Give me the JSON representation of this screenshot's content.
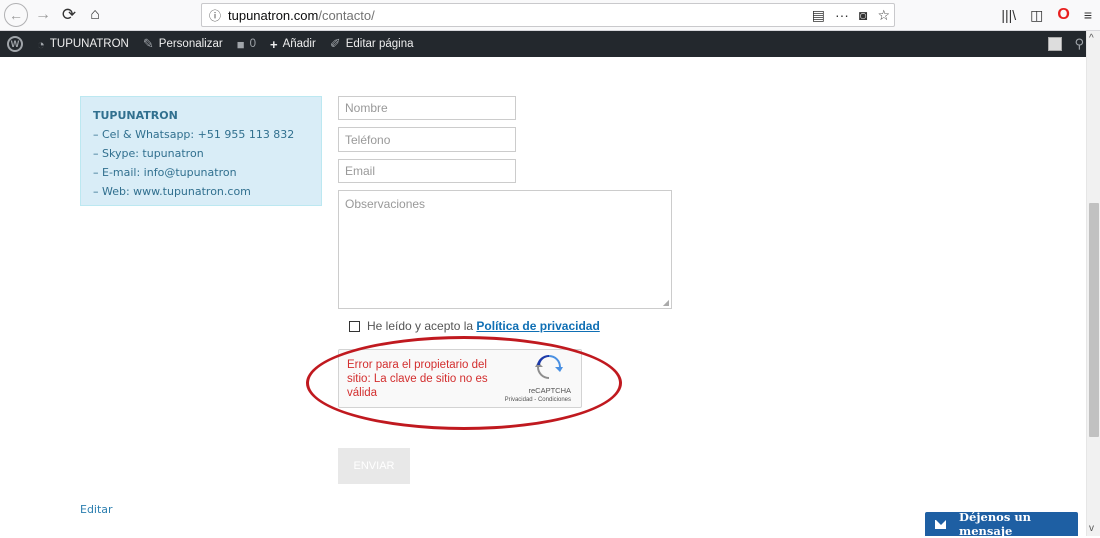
{
  "browser": {
    "back_icon": "←",
    "forward_icon": "→",
    "reload_icon": "⟳",
    "home_icon": "⌂",
    "info_icon": "ⓘ",
    "url_host": "tupunatron.com",
    "url_path": "/contacto/",
    "reader_icon": "▤",
    "more_icon": "···",
    "pocket_icon": "◙",
    "bookmark_icon": "☆",
    "library_icon": "|||\\",
    "sidebar_icon": "◫",
    "opera_icon": "O",
    "menu_icon": "≡"
  },
  "wp_admin_bar": {
    "logo": "W",
    "site_name": "TUPUNATRON",
    "customize": "Personalizar",
    "comments_count": "0",
    "add_new": "Añadir",
    "edit_page": "Editar página"
  },
  "info_box": {
    "title": "TUPUNATRON",
    "lines": [
      "– Cel & Whatsapp: +51 955 113 832",
      "– Skype: tupunatron",
      "– E-mail: info@tupunatron",
      "– Web: www.tupunatron.com"
    ]
  },
  "form": {
    "name_placeholder": "Nombre",
    "phone_placeholder": "Teléfono",
    "email_placeholder": "Email",
    "observations_placeholder": "Observaciones",
    "consent_text": "He leído y acepto la ",
    "privacy_link": "Política de privacidad",
    "submit_label": "ENVIAR"
  },
  "recaptcha": {
    "error": "Error para el propietario del sitio: La clave de sitio no es válida",
    "brand": "reCAPTCHA",
    "terms": "Privacidad - Condiciones"
  },
  "footer": {
    "edit_link": "Editar"
  },
  "chat": {
    "label": "Déjenos un mensaje"
  },
  "colors": {
    "annotation": "#c0191f",
    "wp_bar": "#23282d",
    "info_bg": "#d9edf7",
    "chat_bg": "#1e5fa3"
  }
}
